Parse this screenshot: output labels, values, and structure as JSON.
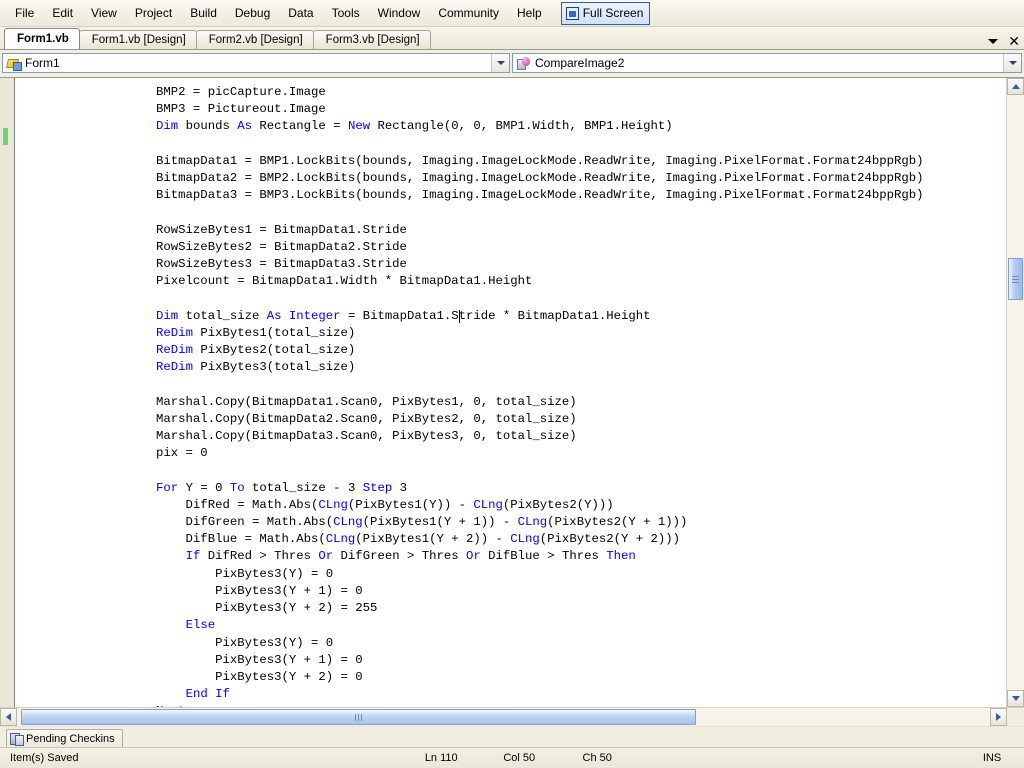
{
  "menubar": {
    "items": [
      {
        "label": "File"
      },
      {
        "label": "Edit"
      },
      {
        "label": "View"
      },
      {
        "label": "Project"
      },
      {
        "label": "Build"
      },
      {
        "label": "Debug"
      },
      {
        "label": "Data"
      },
      {
        "label": "Tools"
      },
      {
        "label": "Window"
      },
      {
        "label": "Community"
      },
      {
        "label": "Help"
      }
    ],
    "fullscreen": {
      "label": "Full Screen",
      "icon": "fullscreen-icon"
    }
  },
  "tabstrip": {
    "tabs": [
      {
        "label": "Form1.vb",
        "active": true
      },
      {
        "label": "Form1.vb [Design]",
        "active": false
      },
      {
        "label": "Form2.vb [Design]",
        "active": false
      },
      {
        "label": "Form3.vb [Design]",
        "active": false
      }
    ],
    "dropdown_icon": "chevron-down-icon",
    "close_icon": "close-icon"
  },
  "navbar": {
    "class_combo": {
      "value": "Form1",
      "icon": "module-icon",
      "arrow_icon": "chevron-down-icon"
    },
    "member_combo": {
      "value": "CompareImage2",
      "icon": "method-icon",
      "arrow_icon": "chevron-down-icon"
    }
  },
  "editor": {
    "code_lines": [
      {
        "indent": 0,
        "tokens": [
          {
            "t": "        BMP2 = picCapture.Image",
            "k": false
          }
        ]
      },
      {
        "indent": 0,
        "tokens": [
          {
            "t": "        BMP3 = Pictureout.Image",
            "k": false
          }
        ]
      },
      {
        "indent": 0,
        "tokens": [
          {
            "t": "        ",
            "k": false
          },
          {
            "t": "Dim",
            "k": true
          },
          {
            "t": " bounds ",
            "k": false
          },
          {
            "t": "As",
            "k": true
          },
          {
            "t": " Rectangle = ",
            "k": false
          },
          {
            "t": "New",
            "k": true
          },
          {
            "t": " Rectangle(0, 0, BMP1.Width, BMP1.Height)",
            "k": false
          }
        ]
      },
      {
        "indent": 0,
        "tokens": [
          {
            "t": "",
            "k": false
          }
        ]
      },
      {
        "indent": 0,
        "tokens": [
          {
            "t": "        BitmapData1 = BMP1.LockBits(bounds, Imaging.ImageLockMode.ReadWrite, Imaging.PixelFormat.Format24bppRgb)",
            "k": false
          }
        ]
      },
      {
        "indent": 0,
        "tokens": [
          {
            "t": "        BitmapData2 = BMP2.LockBits(bounds, Imaging.ImageLockMode.ReadWrite, Imaging.PixelFormat.Format24bppRgb)",
            "k": false
          }
        ]
      },
      {
        "indent": 0,
        "tokens": [
          {
            "t": "        BitmapData3 = BMP3.LockBits(bounds, Imaging.ImageLockMode.ReadWrite, Imaging.PixelFormat.Format24bppRgb)",
            "k": false
          }
        ]
      },
      {
        "indent": 0,
        "tokens": [
          {
            "t": "",
            "k": false
          }
        ]
      },
      {
        "indent": 0,
        "tokens": [
          {
            "t": "        RowSizeBytes1 = BitmapData1.Stride",
            "k": false
          }
        ]
      },
      {
        "indent": 0,
        "tokens": [
          {
            "t": "        RowSizeBytes2 = BitmapData2.Stride",
            "k": false
          }
        ]
      },
      {
        "indent": 0,
        "tokens": [
          {
            "t": "        RowSizeBytes3 = BitmapData3.Stride",
            "k": false
          }
        ]
      },
      {
        "indent": 0,
        "tokens": [
          {
            "t": "        Pixelcount = BitmapData1.Width * BitmapData1.Height",
            "k": false
          }
        ]
      },
      {
        "indent": 0,
        "tokens": [
          {
            "t": "",
            "k": false
          }
        ]
      },
      {
        "indent": 0,
        "tokens": [
          {
            "t": "        ",
            "k": false
          },
          {
            "t": "Dim",
            "k": true
          },
          {
            "t": " total_size ",
            "k": false
          },
          {
            "t": "As",
            "k": true
          },
          {
            "t": " ",
            "k": false
          },
          {
            "t": "Integer",
            "k": true
          },
          {
            "t": " = BitmapData1.S",
            "k": false
          },
          {
            "caret": true
          },
          {
            "t": "tride * BitmapData1.Height",
            "k": false
          }
        ]
      },
      {
        "indent": 0,
        "tokens": [
          {
            "t": "        ",
            "k": false
          },
          {
            "t": "ReDim",
            "k": true
          },
          {
            "t": " PixBytes1(total_size)",
            "k": false
          }
        ]
      },
      {
        "indent": 0,
        "tokens": [
          {
            "t": "        ",
            "k": false
          },
          {
            "t": "ReDim",
            "k": true
          },
          {
            "t": " PixBytes2(total_size)",
            "k": false
          }
        ]
      },
      {
        "indent": 0,
        "tokens": [
          {
            "t": "        ",
            "k": false
          },
          {
            "t": "ReDim",
            "k": true
          },
          {
            "t": " PixBytes3(total_size)",
            "k": false
          }
        ]
      },
      {
        "indent": 0,
        "tokens": [
          {
            "t": "",
            "k": false
          }
        ]
      },
      {
        "indent": 0,
        "tokens": [
          {
            "t": "        Marshal.Copy(BitmapData1.Scan0, PixBytes1, 0, total_size)",
            "k": false
          }
        ]
      },
      {
        "indent": 0,
        "tokens": [
          {
            "t": "        Marshal.Copy(BitmapData2.Scan0, PixBytes2, 0, total_size)",
            "k": false
          }
        ]
      },
      {
        "indent": 0,
        "tokens": [
          {
            "t": "        Marshal.Copy(BitmapData3.Scan0, PixBytes3, 0, total_size)",
            "k": false
          }
        ]
      },
      {
        "indent": 0,
        "tokens": [
          {
            "t": "        pix = 0",
            "k": false
          }
        ]
      },
      {
        "indent": 0,
        "tokens": [
          {
            "t": "",
            "k": false
          }
        ]
      },
      {
        "indent": 0,
        "tokens": [
          {
            "t": "        ",
            "k": false
          },
          {
            "t": "For",
            "k": true
          },
          {
            "t": " Y = 0 ",
            "k": false
          },
          {
            "t": "To",
            "k": true
          },
          {
            "t": " total_size ",
            "k": false
          },
          {
            "t": "-",
            "k": false
          },
          {
            "t": " 3 ",
            "k": false
          },
          {
            "t": "Step",
            "k": true
          },
          {
            "t": " 3",
            "k": false
          }
        ]
      },
      {
        "indent": 0,
        "tokens": [
          {
            "t": "            DifRed = Math.Abs(",
            "k": false
          },
          {
            "t": "CLng",
            "k": true
          },
          {
            "t": "(PixBytes1(Y)) - ",
            "k": false
          },
          {
            "t": "CLng",
            "k": true
          },
          {
            "t": "(PixBytes2(Y)))",
            "k": false
          }
        ]
      },
      {
        "indent": 0,
        "tokens": [
          {
            "t": "            DifGreen = Math.Abs(",
            "k": false
          },
          {
            "t": "CLng",
            "k": true
          },
          {
            "t": "(PixBytes1(Y + 1)) - ",
            "k": false
          },
          {
            "t": "CLng",
            "k": true
          },
          {
            "t": "(PixBytes2(Y + 1)))",
            "k": false
          }
        ]
      },
      {
        "indent": 0,
        "tokens": [
          {
            "t": "            DifBlue = Math.Abs(",
            "k": false
          },
          {
            "t": "CLng",
            "k": true
          },
          {
            "t": "(PixBytes1(Y + 2)) - ",
            "k": false
          },
          {
            "t": "CLng",
            "k": true
          },
          {
            "t": "(PixBytes2(Y + 2)))",
            "k": false
          }
        ]
      },
      {
        "indent": 0,
        "tokens": [
          {
            "t": "            ",
            "k": false
          },
          {
            "t": "If",
            "k": true
          },
          {
            "t": " DifRed > Thres ",
            "k": false
          },
          {
            "t": "Or",
            "k": true
          },
          {
            "t": " DifGreen > Thres ",
            "k": false
          },
          {
            "t": "Or",
            "k": true
          },
          {
            "t": " DifBlue > Thres ",
            "k": false
          },
          {
            "t": "Then",
            "k": true
          }
        ]
      },
      {
        "indent": 0,
        "tokens": [
          {
            "t": "                PixBytes3(Y) = 0",
            "k": false
          }
        ]
      },
      {
        "indent": 0,
        "tokens": [
          {
            "t": "                PixBytes3(Y + 1) = 0",
            "k": false
          }
        ]
      },
      {
        "indent": 0,
        "tokens": [
          {
            "t": "                PixBytes3(Y + 2) = 255",
            "k": false
          }
        ]
      },
      {
        "indent": 0,
        "tokens": [
          {
            "t": "            ",
            "k": false
          },
          {
            "t": "Else",
            "k": true
          }
        ]
      },
      {
        "indent": 0,
        "tokens": [
          {
            "t": "                PixBytes3(Y) = 0",
            "k": false
          }
        ]
      },
      {
        "indent": 0,
        "tokens": [
          {
            "t": "                PixBytes3(Y + 1) = 0",
            "k": false
          }
        ]
      },
      {
        "indent": 0,
        "tokens": [
          {
            "t": "                PixBytes3(Y + 2) = 0",
            "k": false
          }
        ]
      },
      {
        "indent": 0,
        "tokens": [
          {
            "t": "            ",
            "k": false
          },
          {
            "t": "End If",
            "k": true
          }
        ]
      },
      {
        "indent": 0,
        "tokens": [
          {
            "t": "        ",
            "k": false
          },
          {
            "t": "Next",
            "k": true
          }
        ]
      }
    ],
    "change_marker_color": "#6ed36e",
    "keyword_color": "#0000ff",
    "text_color": "#000000",
    "background_color": "#ffffff"
  },
  "scrollbars": {
    "vertical": {
      "up_icon": "scroll-up-icon",
      "down_icon": "scroll-down-icon"
    },
    "horizontal": {
      "left_icon": "scroll-left-icon",
      "right_icon": "scroll-right-icon"
    }
  },
  "dockbar": {
    "pending_checkins": {
      "label": "Pending Checkins",
      "icon": "pending-checkins-icon"
    }
  },
  "statusbar": {
    "message": "Item(s) Saved",
    "line": "Ln 110",
    "column": "Col 50",
    "character": "Ch 50",
    "insert_mode": "INS"
  }
}
